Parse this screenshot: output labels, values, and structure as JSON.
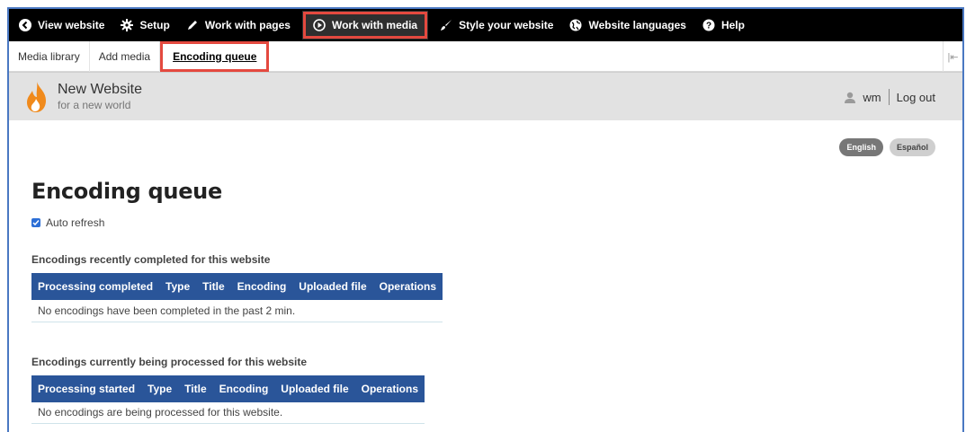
{
  "topbar": {
    "items": [
      {
        "label": "View website",
        "icon": "arrow-left-circle-icon"
      },
      {
        "label": "Setup",
        "icon": "gear-icon"
      },
      {
        "label": "Work with pages",
        "icon": "pencil-icon"
      },
      {
        "label": "Work with media",
        "icon": "play-circle-icon"
      },
      {
        "label": "Style your website",
        "icon": "brush-icon"
      },
      {
        "label": "Website languages",
        "icon": "globe-icon"
      },
      {
        "label": "Help",
        "icon": "question-circle-icon"
      }
    ],
    "active_index": 3
  },
  "subbar": {
    "tabs": [
      {
        "label": "Media library"
      },
      {
        "label": "Add media"
      },
      {
        "label": "Encoding queue"
      }
    ],
    "active_index": 2
  },
  "site": {
    "name": "New Website",
    "slogan": "for a new world",
    "user": "wm",
    "logout_label": "Log out"
  },
  "languages": [
    {
      "label": "English",
      "active": true
    },
    {
      "label": "Español",
      "active": false
    }
  ],
  "page": {
    "title": "Encoding queue",
    "auto_refresh_label": "Auto refresh",
    "auto_refresh_checked": true
  },
  "completed": {
    "heading": "Encodings recently completed for this website",
    "columns": [
      "Processing completed",
      "Type",
      "Title",
      "Encoding",
      "Uploaded file",
      "Operations"
    ],
    "empty_message": "No encodings have been completed in the past 2 min."
  },
  "processing": {
    "heading": "Encodings currently being processed for this website",
    "columns": [
      "Processing started",
      "Type",
      "Title",
      "Encoding",
      "Uploaded file",
      "Operations"
    ],
    "empty_message": "No encodings are being processed for this website."
  },
  "colors": {
    "highlight": "#e4493f",
    "table_header": "#2a5599",
    "topbar": "#000000",
    "checkbox": "#2d6fd6"
  }
}
